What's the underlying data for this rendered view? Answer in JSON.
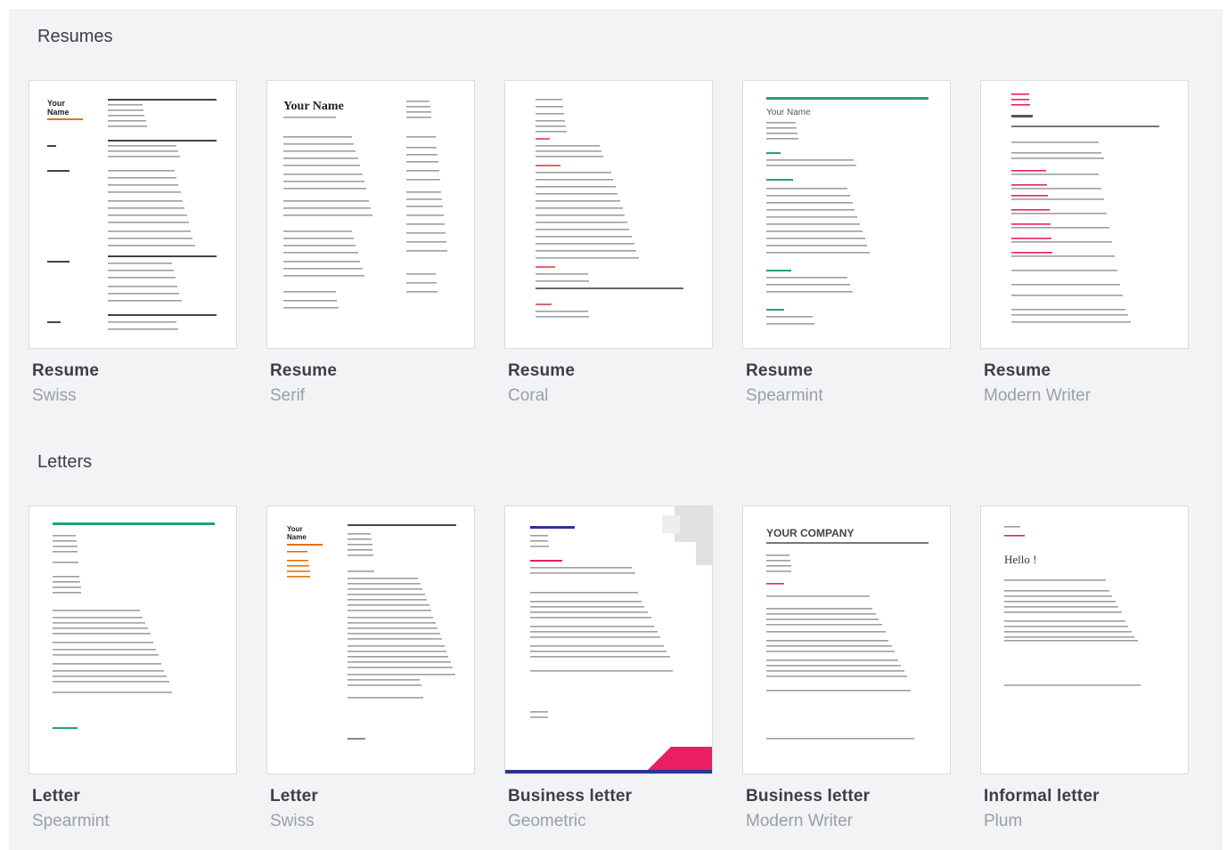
{
  "sections": [
    {
      "title": "Resumes",
      "templates": [
        {
          "title": "Resume",
          "subtitle": "Swiss"
        },
        {
          "title": "Resume",
          "subtitle": "Serif"
        },
        {
          "title": "Resume",
          "subtitle": "Coral"
        },
        {
          "title": "Resume",
          "subtitle": "Spearmint"
        },
        {
          "title": "Resume",
          "subtitle": "Modern Writer"
        }
      ]
    },
    {
      "title": "Letters",
      "templates": [
        {
          "title": "Letter",
          "subtitle": "Spearmint"
        },
        {
          "title": "Letter",
          "subtitle": "Swiss"
        },
        {
          "title": "Business letter",
          "subtitle": "Geometric"
        },
        {
          "title": "Business letter",
          "subtitle": "Modern Writer"
        },
        {
          "title": "Informal letter",
          "subtitle": "Plum"
        }
      ]
    }
  ],
  "thumbs": {
    "swiss_name": "Your Name",
    "serif_name": "Your Name",
    "spearmint_name": "Your Name",
    "company": "YOUR COMPANY",
    "hello": "Hello !",
    "colors": {
      "swiss": "#e8710a",
      "coral": "#e06666",
      "spearmint": "#20a082",
      "modern": "#e91e63",
      "geo_blue": "#283593",
      "geo_pink": "#e91e63",
      "text": "#555555"
    }
  }
}
